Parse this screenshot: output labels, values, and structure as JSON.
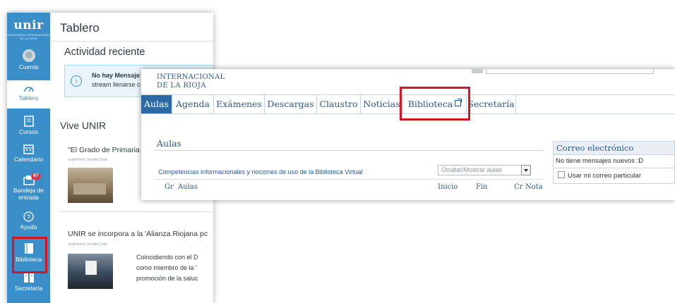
{
  "canvas": {
    "logo": {
      "brand": "unir",
      "tagline": "UNIVERSIDAD INTERNACIONAL DE LA RIOJA"
    },
    "sidebar": {
      "items": [
        {
          "label": "Cuenta",
          "icon": "user-avatar-icon"
        },
        {
          "label": "Tablero",
          "icon": "dashboard-icon"
        },
        {
          "label": "Cursos",
          "icon": "book-icon"
        },
        {
          "label": "Calendario",
          "icon": "calendar-icon"
        },
        {
          "label": "Bandeja de entrada",
          "icon": "inbox-icon",
          "badge": "67"
        },
        {
          "label": "Ayuda",
          "icon": "help-icon"
        },
        {
          "label": "Biblioteca",
          "icon": "library-icon"
        },
        {
          "label": "Secretaría",
          "icon": "secretary-icon"
        }
      ]
    },
    "title": "Tablero",
    "recent_activity": {
      "title": "Actividad reciente",
      "alert_line1_bold": "No hay Mensaje",
      "alert_line2": "stream llenarse c"
    },
    "vive": {
      "title": "Vive UNIR",
      "posts": [
        {
          "title": "\"El Grado de Primaria",
          "date": "undefined, Invalid Date"
        },
        {
          "title": "UNIR se incorpora a la 'Alianza Riojana pc",
          "date": "undefined, Invalid Date",
          "lines": [
            "Coincidiendo con el D",
            "como miembro de la '",
            "promoción de la saluc"
          ]
        }
      ]
    }
  },
  "unir": {
    "header": {
      "line1": "INTERNACIONAL",
      "line2": "DE LA RIOJA"
    },
    "tabs": [
      "Aulas",
      "Agenda",
      "Exámenes",
      "Descargas",
      "Claustro",
      "Noticias",
      "Biblioteca",
      "Secretaría"
    ],
    "active_tab": "Aulas",
    "aulas": {
      "title": "Aulas",
      "course": "Competencias informacionales y nociones de uso de la Biblioteca Virtual",
      "toggle": "Ocultar/Mostrar aulas",
      "columns": [
        "Gr",
        "Aulas",
        "Inicio",
        "Fin",
        "Cr",
        "Nota"
      ]
    },
    "email": {
      "title": "Correo electrónico",
      "message": "No tiene mensajes nuevos :D",
      "checkbox_label": "Usar mi correo particular"
    }
  },
  "colors": {
    "canvas_blue": "#3b8fc9",
    "unir_blue": "#2d6aa3",
    "highlight_red": "#d3161f",
    "badge_red": "#e0304b"
  }
}
